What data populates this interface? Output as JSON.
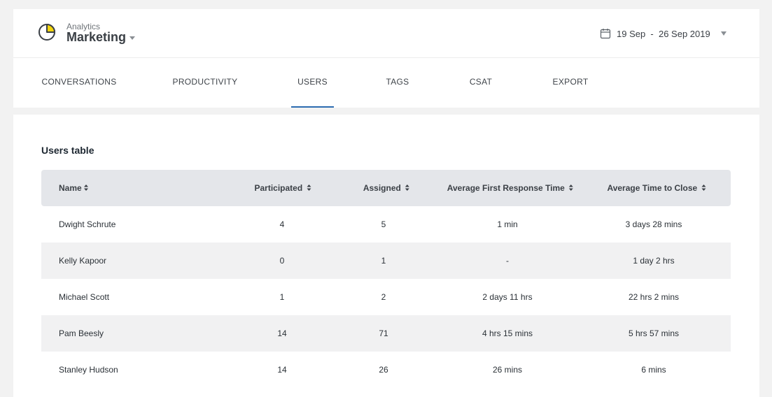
{
  "header": {
    "app_subtitle": "Analytics",
    "app_name": "Marketing",
    "date_range": "19 Sep  -  26 Sep 2019"
  },
  "tabs": [
    {
      "label": "CONVERSATIONS",
      "active": false
    },
    {
      "label": "PRODUCTIVITY",
      "active": false
    },
    {
      "label": "USERS",
      "active": true
    },
    {
      "label": "TAGS",
      "active": false
    },
    {
      "label": "CSAT",
      "active": false
    },
    {
      "label": "EXPORT",
      "active": false
    }
  ],
  "users_table": {
    "title": "Users table",
    "columns": [
      "Name",
      "Participated",
      "Assigned",
      "Average First Response Time",
      "Average Time to Close"
    ],
    "rows": [
      [
        "Dwight Schrute",
        "4",
        "5",
        "1 min",
        "3 days 28 mins"
      ],
      [
        "Kelly Kapoor",
        "0",
        "1",
        "-",
        "1 day 2 hrs"
      ],
      [
        "Michael Scott",
        "1",
        "2",
        "2 days 11 hrs",
        "22 hrs 2 mins"
      ],
      [
        "Pam Beesly",
        "14",
        "71",
        "4 hrs 15 mins",
        "5 hrs 57 mins"
      ],
      [
        "Stanley Hudson",
        "14",
        "26",
        "26 mins",
        "6 mins"
      ]
    ]
  },
  "colors": {
    "logo_accent": "#f2d40c",
    "active_tab_underline": "#2b6cb0",
    "table_header_bg": "#e4e6ea",
    "alt_row_bg": "#f1f1f2"
  }
}
